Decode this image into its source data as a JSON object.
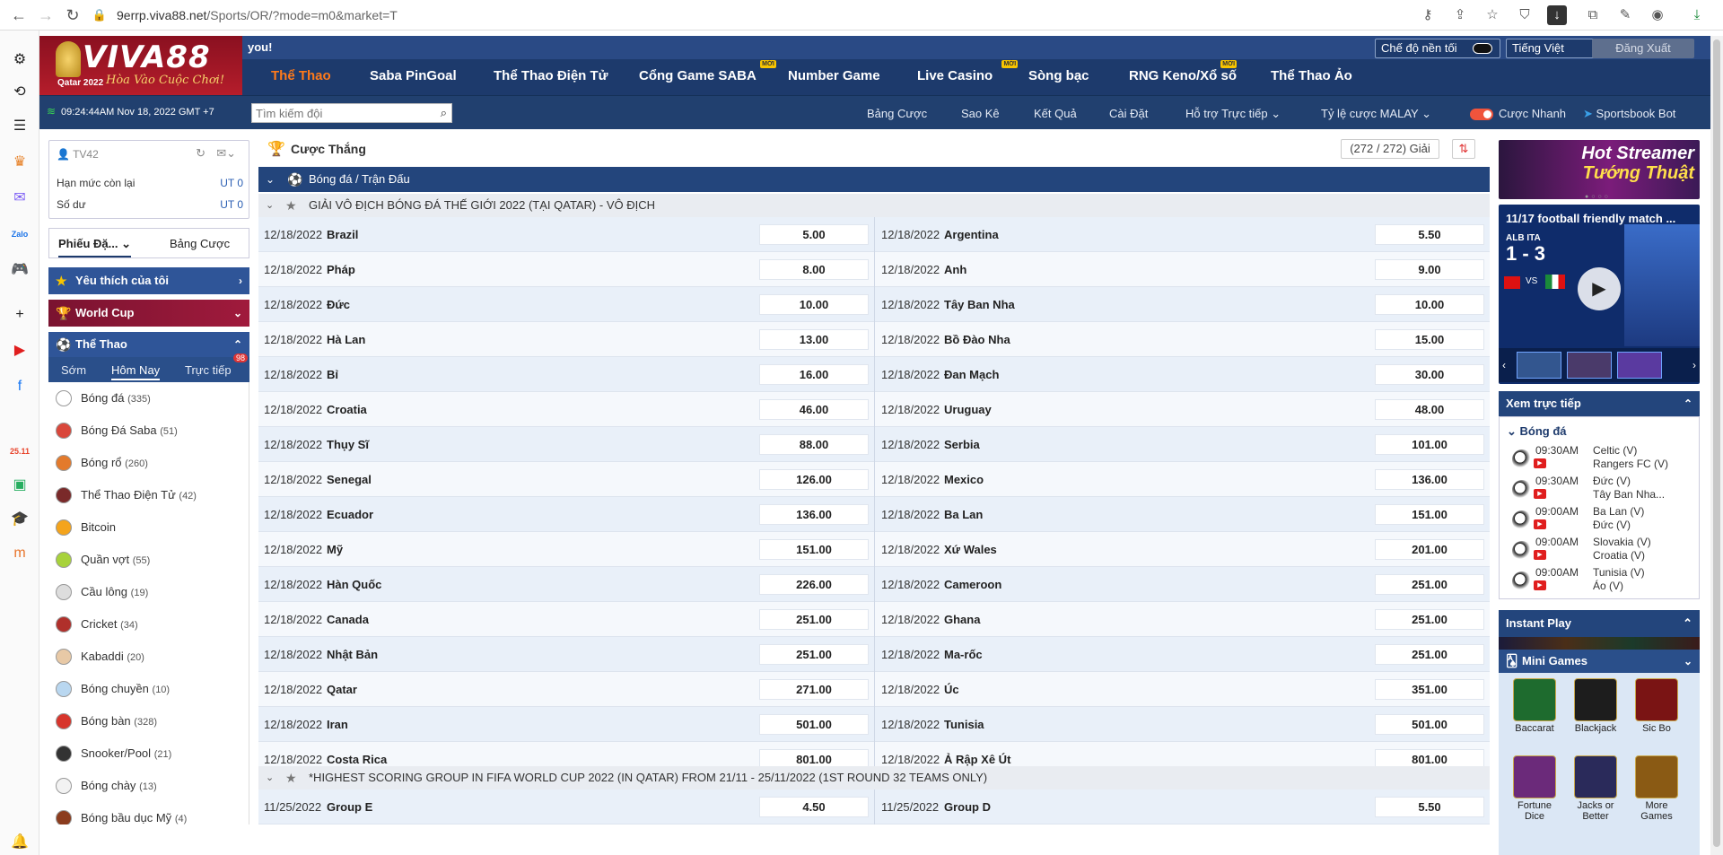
{
  "browser": {
    "url_host": "9errp.viva88.net",
    "url_path": "/Sports/OR/?mode=m0&market=T"
  },
  "header": {
    "brand": "VIVA88",
    "slogan": "Hòa Vào Cuộc Chơi!",
    "event_tag": "Qatar 2022",
    "you_msg": "you!",
    "dark_mode_label": "Chế độ nền tối",
    "language": "Tiếng Việt",
    "logout_label": "Đăng Xuất",
    "new_badge": "MỚI",
    "menu": [
      {
        "label": "Thể Thao"
      },
      {
        "label": "Saba PinGoal"
      },
      {
        "label": "Thể Thao Điện Tử"
      },
      {
        "label": "Cổng Game SABA"
      },
      {
        "label": "Number Game"
      },
      {
        "label": "Live Casino"
      },
      {
        "label": "Sòng bạc"
      },
      {
        "label": "RNG Keno/Xổ số"
      },
      {
        "label": "Thể Thao Ảo"
      }
    ]
  },
  "subnav": {
    "clock": "09:24:44AM Nov 18, 2022 GMT +7",
    "search_placeholder": "Tìm kiếm đội",
    "items": [
      "Bảng Cược",
      "Sao Kê",
      "Kết Quả",
      "Cài Đặt",
      "Hỗ trợ Trực tiếp",
      "Tỷ lệ cược MALAY",
      "Cược Nhanh",
      "Sportsbook Bot"
    ]
  },
  "user": {
    "username": "TV42",
    "credit_label": "Hạn mức còn lại",
    "credit_value": "UT 0",
    "balance_label": "Số dư",
    "balance_value": "UT 0",
    "tab_betslip": "Phiếu Đặ...",
    "tab_bets": "Bảng Cược"
  },
  "left_categories": {
    "favorites": "Yêu thích của tôi",
    "worldcup": "World Cup",
    "sports": "Thể Thao"
  },
  "sport_tabs": {
    "early": "Sớm",
    "today": "Hôm Nay",
    "live": "Trực tiếp",
    "live_count": "98"
  },
  "sports": [
    {
      "name": "Bóng đá",
      "count": "(335)",
      "color": "#ffffff"
    },
    {
      "name": "Bóng Đá Saba",
      "count": "(51)",
      "color": "#d9473b"
    },
    {
      "name": "Bóng rổ",
      "count": "(260)",
      "color": "#e37a2c"
    },
    {
      "name": "Thể Thao Điện Tử",
      "count": "(42)",
      "color": "#7a2a2a"
    },
    {
      "name": "Bitcoin",
      "count": "",
      "color": "#f4a41c"
    },
    {
      "name": "Quần vợt",
      "count": "(55)",
      "color": "#a7d23b"
    },
    {
      "name": "Cầu lông",
      "count": "(19)",
      "color": "#dddddd"
    },
    {
      "name": "Cricket",
      "count": "(34)",
      "color": "#b0302b"
    },
    {
      "name": "Kabaddi",
      "count": "(20)",
      "color": "#e8c9a6"
    },
    {
      "name": "Bóng chuyền",
      "count": "(10)",
      "color": "#b9d7f0"
    },
    {
      "name": "Bóng bàn",
      "count": "(328)",
      "color": "#d7352c"
    },
    {
      "name": "Snooker/Pool",
      "count": "(21)",
      "color": "#333333"
    },
    {
      "name": "Bóng chày",
      "count": "(13)",
      "color": "#f2f2f2"
    },
    {
      "name": "Bóng bầu dục Mỹ",
      "count": "(4)",
      "color": "#8b3c1e"
    }
  ],
  "main": {
    "title": "Cược Thắng",
    "count": "(272 / 272) Giải",
    "section": "Bóng đá / Trận Đấu",
    "league1": "GIẢI VÔ ĐỊCH BÓNG ĐÁ THẾ GIỚI 2022 (TẠI QATAR) - VÔ ĐỊCH",
    "league2": "*HIGHEST SCORING GROUP IN FIFA WORLD CUP 2022 (IN QATAR) FROM 21/11 - 25/11/2022 (1ST ROUND 32 TEAMS ONLY)",
    "rows": [
      {
        "d1": "12/18/2022",
        "t1": "Brazil",
        "o1": "5.00",
        "d2": "12/18/2022",
        "t2": "Argentina",
        "o2": "5.50"
      },
      {
        "d1": "12/18/2022",
        "t1": "Pháp",
        "o1": "8.00",
        "d2": "12/18/2022",
        "t2": "Anh",
        "o2": "9.00"
      },
      {
        "d1": "12/18/2022",
        "t1": "Đức",
        "o1": "10.00",
        "d2": "12/18/2022",
        "t2": "Tây Ban Nha",
        "o2": "10.00"
      },
      {
        "d1": "12/18/2022",
        "t1": "Hà Lan",
        "o1": "13.00",
        "d2": "12/18/2022",
        "t2": "Bồ Đào Nha",
        "o2": "15.00"
      },
      {
        "d1": "12/18/2022",
        "t1": "Bỉ",
        "o1": "16.00",
        "d2": "12/18/2022",
        "t2": "Đan Mạch",
        "o2": "30.00"
      },
      {
        "d1": "12/18/2022",
        "t1": "Croatia",
        "o1": "46.00",
        "d2": "12/18/2022",
        "t2": "Uruguay",
        "o2": "48.00"
      },
      {
        "d1": "12/18/2022",
        "t1": "Thụy Sĩ",
        "o1": "88.00",
        "d2": "12/18/2022",
        "t2": "Serbia",
        "o2": "101.00"
      },
      {
        "d1": "12/18/2022",
        "t1": "Senegal",
        "o1": "126.00",
        "d2": "12/18/2022",
        "t2": "Mexico",
        "o2": "136.00"
      },
      {
        "d1": "12/18/2022",
        "t1": "Ecuador",
        "o1": "136.00",
        "d2": "12/18/2022",
        "t2": "Ba Lan",
        "o2": "151.00"
      },
      {
        "d1": "12/18/2022",
        "t1": "Mỹ",
        "o1": "151.00",
        "d2": "12/18/2022",
        "t2": "Xứ Wales",
        "o2": "201.00"
      },
      {
        "d1": "12/18/2022",
        "t1": "Hàn Quốc",
        "o1": "226.00",
        "d2": "12/18/2022",
        "t2": "Cameroon",
        "o2": "251.00"
      },
      {
        "d1": "12/18/2022",
        "t1": "Canada",
        "o1": "251.00",
        "d2": "12/18/2022",
        "t2": "Ghana",
        "o2": "251.00"
      },
      {
        "d1": "12/18/2022",
        "t1": "Nhật Bản",
        "o1": "251.00",
        "d2": "12/18/2022",
        "t2": "Ma-rốc",
        "o2": "251.00"
      },
      {
        "d1": "12/18/2022",
        "t1": "Qatar",
        "o1": "271.00",
        "d2": "12/18/2022",
        "t2": "Úc",
        "o2": "351.00"
      },
      {
        "d1": "12/18/2022",
        "t1": "Iran",
        "o1": "501.00",
        "d2": "12/18/2022",
        "t2": "Tunisia",
        "o2": "501.00"
      },
      {
        "d1": "12/18/2022",
        "t1": "Costa Rica",
        "o1": "801.00",
        "d2": "12/18/2022",
        "t2": "Ả Rập Xê Út",
        "o2": "801.00"
      }
    ],
    "group_row": {
      "d1": "11/25/2022",
      "t1": "Group E",
      "o1": "4.50",
      "d2": "11/25/2022",
      "t2": "Group D",
      "o2": "5.50"
    }
  },
  "right": {
    "banner_line1": "Hot Streamer",
    "banner_line2": "Tướng Thuật",
    "video_title": "11/17 football friendly match ...",
    "video_teams": "ALB      ITA",
    "video_score": "1  -  3",
    "video_vs": "VS",
    "live_title": "Xem trực tiếp",
    "live_sport": "Bóng đá",
    "live_matches": [
      {
        "time": "09:30AM",
        "home": "Celtic (V)",
        "away": "Rangers FC (V)"
      },
      {
        "time": "09:30AM",
        "home": "Đức (V)",
        "away": "Tây Ban Nha..."
      },
      {
        "time": "09:00AM",
        "home": "Ba Lan (V)",
        "away": "Đức (V)"
      },
      {
        "time": "09:00AM",
        "home": "Slovakia (V)",
        "away": "Croatia (V)"
      },
      {
        "time": "09:00AM",
        "home": "Tunisia (V)",
        "away": "Áo (V)"
      }
    ],
    "instant_play": "Instant Play",
    "mini_games": "Mini Games",
    "games": [
      {
        "name": "Baccarat",
        "color": "#1e6b2e"
      },
      {
        "name": "Blackjack",
        "color": "#1d1d1d"
      },
      {
        "name": "Sic Bo",
        "color": "#7a1414"
      },
      {
        "name": "Fortune Dice",
        "color": "#6b2a7a"
      },
      {
        "name": "Jacks or Better",
        "color": "#2a2a5a"
      },
      {
        "name": "More Games",
        "color": "#8a5a14"
      }
    ]
  }
}
